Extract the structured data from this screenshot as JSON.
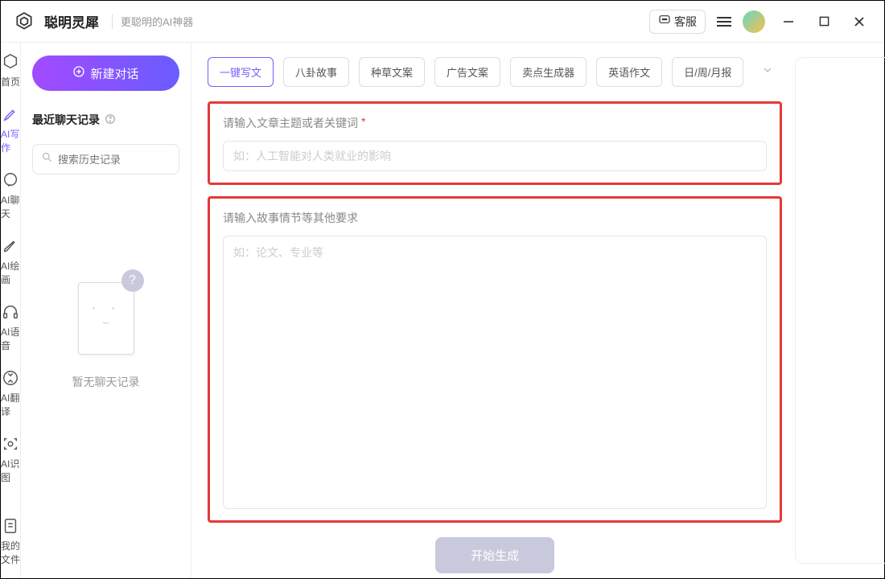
{
  "header": {
    "title": "聪明灵犀",
    "subtitle": "更聪明的AI神器",
    "kefu_label": "客服"
  },
  "nav": {
    "items": [
      {
        "label": "首页",
        "icon": "home-icon"
      },
      {
        "label": "AI写作",
        "icon": "pen-icon",
        "active": true
      },
      {
        "label": "AI聊天",
        "icon": "chat-icon"
      },
      {
        "label": "AI绘画",
        "icon": "brush-icon"
      },
      {
        "label": "AI语音",
        "icon": "headset-icon"
      },
      {
        "label": "AI翻译",
        "icon": "translate-icon"
      },
      {
        "label": "AI识图",
        "icon": "vision-icon"
      }
    ],
    "bottom": {
      "label": "我的文件",
      "icon": "file-icon"
    }
  },
  "history": {
    "new_chat_label": "新建对话",
    "recent_label": "最近聊天记录",
    "search_placeholder": "搜索历史记录",
    "empty_label": "暂无聊天记录"
  },
  "main": {
    "pills": [
      "一键写文",
      "八卦故事",
      "种草文案",
      "广告文案",
      "卖点生成器",
      "英语作文",
      "日/周/月报"
    ],
    "active_pill": 0,
    "field1_label": "请输入文章主题或者关键词",
    "field1_placeholder": "如：人工智能对人类就业的影响",
    "field2_label": "请输入故事情节等其他要求",
    "field2_placeholder": "如：论文、专业等",
    "generate_label": "开始生成"
  }
}
